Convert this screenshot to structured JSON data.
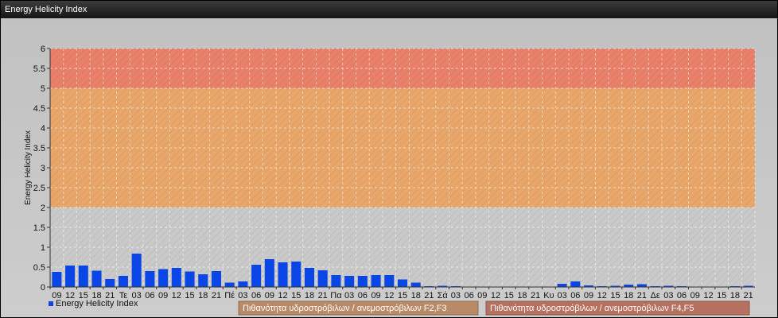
{
  "window": {
    "title": "Energy Helicity Index"
  },
  "colors": {
    "bar": "#0a45e6",
    "band_high": "#e8806a",
    "band_mid": "#e8a66a",
    "band_low": "#c9c9c9",
    "legend_f2f3": "#b98a68",
    "legend_f4f5": "#b5705f"
  },
  "legend": {
    "series_label": "Energy Helicity Index",
    "band_f2f3": "Πιθανότητα υδροστρόβιλων / ανεμοστρόβιλων F2,F3",
    "band_f4f5": "Πιθανότητα υδροστρόβιλων / ανεμοστρόβιλων F4,F5"
  },
  "chart_data": {
    "type": "bar",
    "ylabel": "Energy Helicity Index",
    "ylim": [
      0,
      6
    ],
    "yticks": [
      "0",
      "0.5",
      "1",
      "1.5",
      "2",
      "2.5",
      "3",
      "3.5",
      "4",
      "4.5",
      "5",
      "5.5",
      "6"
    ],
    "grid": true,
    "bands": [
      {
        "from": 5,
        "to": 6,
        "color": "#e8806a"
      },
      {
        "from": 2,
        "to": 5,
        "color": "#e8a66a"
      }
    ],
    "categories": [
      "09",
      "12",
      "15",
      "18",
      "21",
      "Τε",
      "03",
      "06",
      "09",
      "12",
      "15",
      "18",
      "21",
      "Πέ",
      "03",
      "06",
      "09",
      "12",
      "15",
      "18",
      "21",
      "Πα",
      "03",
      "06",
      "09",
      "12",
      "15",
      "18",
      "21",
      "Σά",
      "03",
      "06",
      "09",
      "12",
      "15",
      "18",
      "21",
      "Κυ",
      "03",
      "06",
      "09",
      "12",
      "15",
      "18",
      "21",
      "Δε",
      "03",
      "06",
      "09",
      "12",
      "15",
      "18",
      "21"
    ],
    "series": [
      {
        "values": [
          0.38,
          0.54,
          0.54,
          0.41,
          0.2,
          0.28,
          0.84,
          0.4,
          0.45,
          0.48,
          0.39,
          0.32,
          0.4,
          0.11,
          0.14,
          0.56,
          0.7,
          0.62,
          0.64,
          0.48,
          0.42,
          0.3,
          0.28,
          0.28,
          0.3,
          0.3,
          0.19,
          0.11,
          0.02,
          0.03,
          0.02,
          0.01,
          0.01,
          0.01,
          0.01,
          0.01,
          0.01,
          0.01,
          0.08,
          0.14,
          0.04,
          0.02,
          0.03,
          0.06,
          0.07,
          0.02,
          0.03,
          0.02,
          0.01,
          0.01,
          0.01,
          0.02,
          0.03
        ]
      }
    ]
  }
}
